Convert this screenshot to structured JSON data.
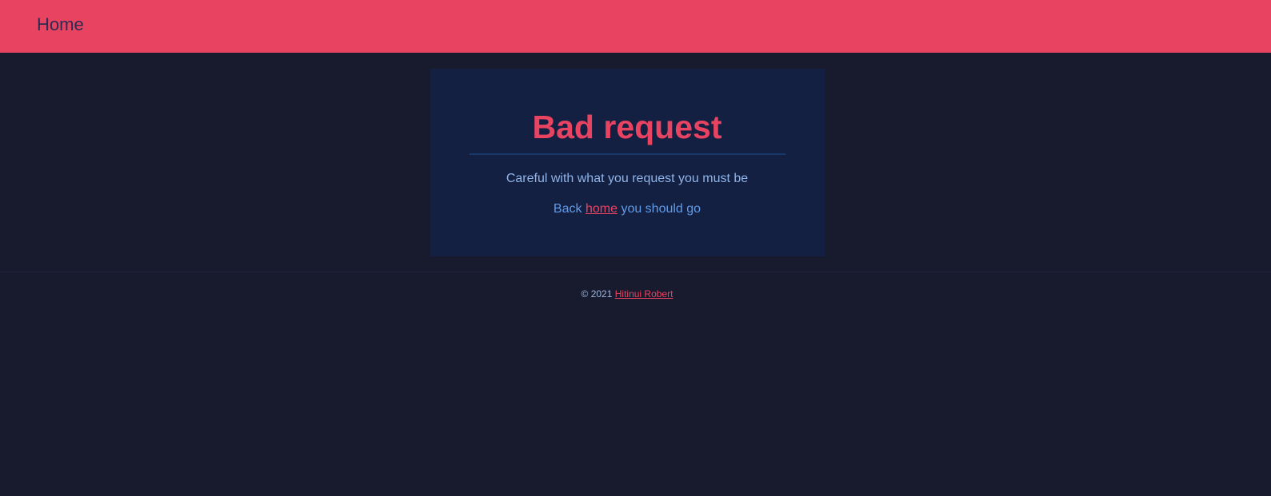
{
  "nav": {
    "home_label": "Home"
  },
  "card": {
    "title": "Bad request",
    "message": "Careful with what you request you must be",
    "back_prefix": "Back",
    "back_link": "home",
    "back_suffix": "you should go"
  },
  "footer": {
    "copyright": "© 2021",
    "author_link": "Hitinui Robert"
  },
  "colors": {
    "brand": "#e94362",
    "background": "#181a2e",
    "card_background": "#142042",
    "body_text": "#8fb4e8"
  }
}
